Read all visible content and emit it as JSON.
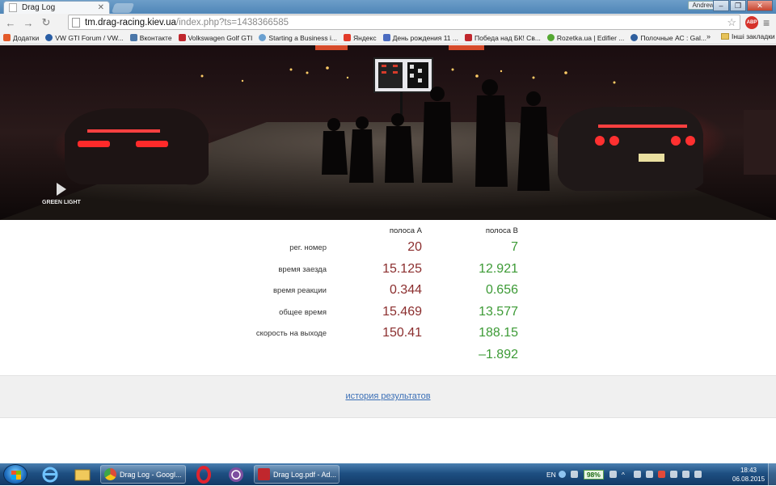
{
  "browser": {
    "tab_title": "Drag Log",
    "profile_name": "Andrew",
    "url_host": "tm.drag-racing.kiev.ua",
    "url_rest": "/index.php?ts=1438366585",
    "extension_badge": "ABP"
  },
  "bookmarks": {
    "items": [
      {
        "label": "Додатки",
        "color": "#e35a2a"
      },
      {
        "label": "VW GTI Forum / VW...",
        "color": "#2a5ea5"
      },
      {
        "label": "Вконтакте",
        "color": "#4a76a8"
      },
      {
        "label": "Volkswagen Golf GTI",
        "color": "#c0272d"
      },
      {
        "label": "Starting a Business i...",
        "color": "#6aa0d0"
      },
      {
        "label": "Яндекс",
        "color": "#e23b2a"
      },
      {
        "label": "День рождения 11 ...",
        "color": "#4b6cc1"
      },
      {
        "label": "Победа над БК! Св...",
        "color": "#c0272d"
      },
      {
        "label": "Rozetka.ua | Edifier ...",
        "color": "#55a833"
      },
      {
        "label": "Полочные АС : Gal...",
        "color": "#2f5f9e"
      }
    ],
    "more": "»",
    "other_folder": "Інші закладки"
  },
  "hero": {
    "logo_text": "GREEN LIGHT"
  },
  "results": {
    "lane_a_header": "полоса A",
    "lane_b_header": "полоса B",
    "rows": [
      {
        "label": "рег. номер",
        "a": "20",
        "b": "7"
      },
      {
        "label": "время заезда",
        "a": "15.125",
        "b": "12.921"
      },
      {
        "label": "время реакции",
        "a": "0.344",
        "b": "0.656"
      },
      {
        "label": "общее время",
        "a": "15.469",
        "b": "13.577"
      },
      {
        "label": "скорость на выходе",
        "a": "150.41",
        "b": "188.15"
      }
    ],
    "difference": "–1.892",
    "colors": {
      "lane_a": "#8b2e2e",
      "lane_b": "#3c9a35"
    }
  },
  "footer": {
    "history_link": "история результатов"
  },
  "taskbar": {
    "tasks": [
      {
        "label": "Drag Log - Googl...",
        "color": "#dd4b39"
      },
      {
        "label": "Drag Log.pdf - Ad...",
        "color": "#c0272d"
      }
    ],
    "language": "EN",
    "battery": "98%",
    "time": "18:43",
    "date": "06.08.2015"
  }
}
